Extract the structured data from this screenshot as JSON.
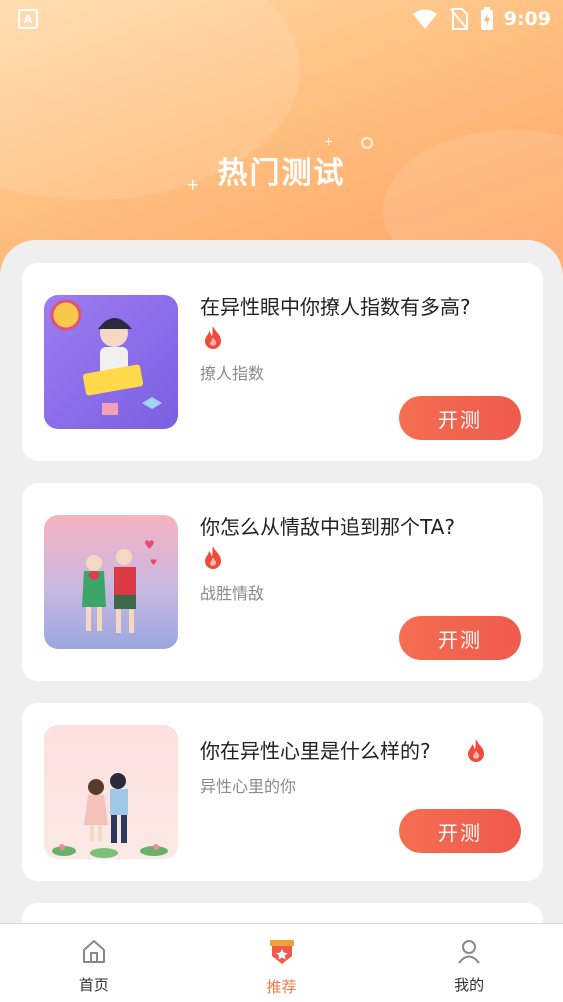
{
  "status_bar": {
    "time": "9:09",
    "app_badge": "A"
  },
  "header": {
    "title": "热门测试"
  },
  "cards": [
    {
      "title": "在异性眼中你撩人指数有多高?",
      "subtitle": "撩人指数",
      "button": "开测",
      "thumb_text": "在异性眼中你撩人指数有多高?"
    },
    {
      "title": "你怎么从情敌中追到那个TA?",
      "subtitle": "战胜情敌",
      "button": "开测",
      "thumb_text": "你怎么从情敌中追到那个TA?"
    },
    {
      "title": "你在异性心里是什么样的?",
      "subtitle": "异性心里的你",
      "button": "开测",
      "thumb_text": "你在异性心里是什么样的?"
    }
  ],
  "tabbar": {
    "items": [
      {
        "label": "首页",
        "icon": "home-icon",
        "active": false
      },
      {
        "label": "推荐",
        "icon": "badge-icon",
        "active": true
      },
      {
        "label": "我的",
        "icon": "user-icon",
        "active": false
      }
    ]
  },
  "colors": {
    "accent": "#f07a47",
    "button": "#ef5a4c",
    "header_top": "#ffd9a8",
    "header_bottom": "#ff9f62"
  }
}
